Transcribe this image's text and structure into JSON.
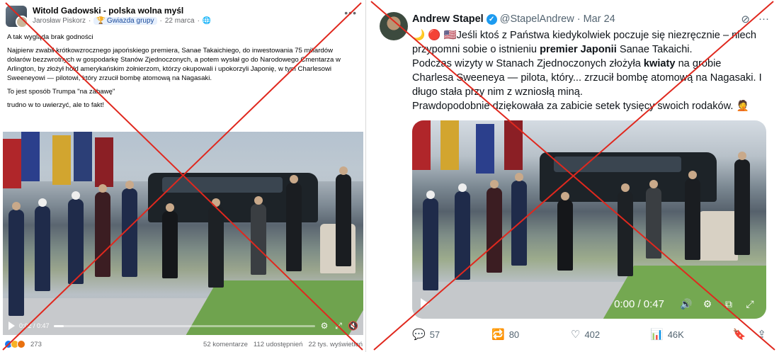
{
  "left_post": {
    "group_name": "Witold Gadowski - polska wolna myśl",
    "author": "Jarosław Piskorz",
    "badge": "Gwiazda grupy",
    "date": "22 marca",
    "privacy_icon": "globe-icon",
    "paragraphs": [
      "A tak wygląda brak godności",
      "Najpierw zwabił krótkowzrocznego japońskiego premiera, Sanae Takaichiego, do inwestowania 75 miliardów dolarów bezzwrotnych w gospodarkę Stanów Zjednoczonych, a potem wysłał go do Narodowego Cmentarza w Arlington, by złożył hołd amerykańskim żołnierzom, którzy okupowali i upokorzyli Japonię, w tym Charlesowi Sweeneyowi — pilotowi, który zrzucił bombę atomową na Nagasaki.",
      "To jest sposób Trumpa \"na zabawę\"",
      "trudno w to uwierzyć, ale to fakt!"
    ],
    "video": {
      "time": "0:02 / 0:47",
      "progress_fraction": 0.04
    },
    "reaction_count": "273",
    "comments": "52 komentarze",
    "shares": "112 udostępnień",
    "views": "22 tys. wyświetleń"
  },
  "right_post": {
    "name": "Andrew Stapel",
    "handle": "@StapelAndrew",
    "date": "Mar 24",
    "text_lines": [
      {
        "pre": "🌙 🔴 🇺🇸Jeśli ktoś z Państwa kiedykolwiek poczuje się niezręcznie – niech",
        "bold": "",
        "post": ""
      },
      {
        "pre": "przypomni sobie o istnieniu ",
        "bold": "premier Japonii",
        "post": " Sanae Takaichi."
      },
      {
        "pre": "  Podczas wizyty w Stanach Zjednoczonych złożyła ",
        "bold": "kwiaty",
        "post": " na grobie"
      },
      {
        "pre": "Charlesa Sweeneya — pilota, który... zrzucił bombę atomową na Nagasaki. I",
        "bold": "",
        "post": ""
      },
      {
        "pre": "długo stała przy nim z wzniosłą miną.",
        "bold": "",
        "post": ""
      },
      {
        "pre": "  Prawdopodobnie dziękowała za zabicie setek tysięcy swoich rodaków. 🤦",
        "bold": "",
        "post": ""
      }
    ],
    "video": {
      "time": "0:00 / 0:47"
    },
    "replies": "57",
    "reposts": "80",
    "likes": "402",
    "views": "46K"
  },
  "colors": {
    "cross": "#e0281e",
    "verified": "#1d9bf0"
  }
}
